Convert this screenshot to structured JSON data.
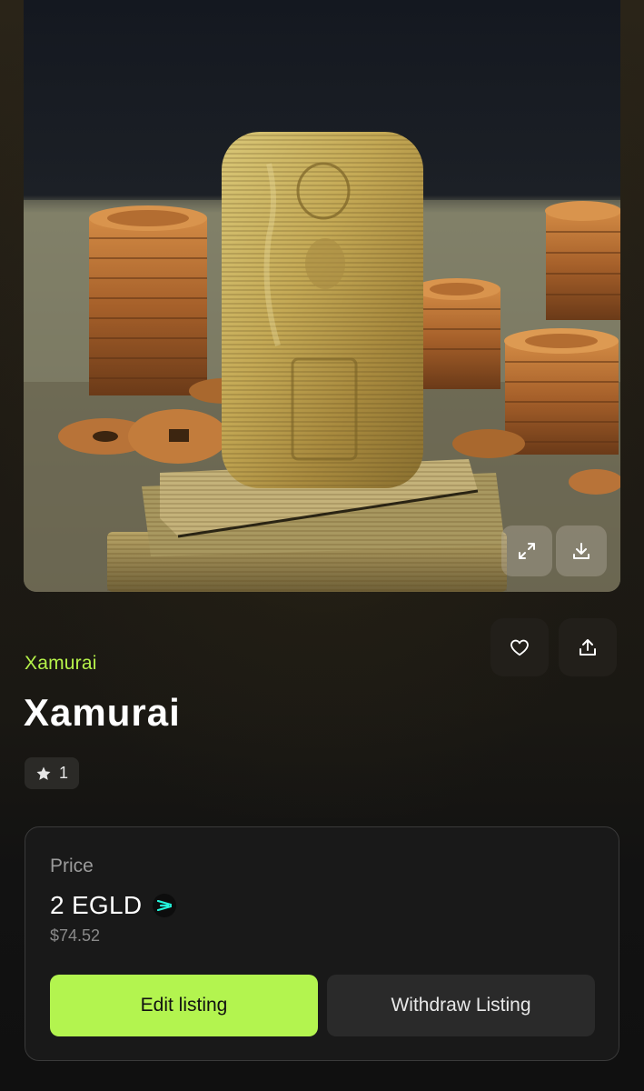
{
  "nft": {
    "collection": "Xamurai",
    "title": "Xamurai",
    "favorites_count": "1",
    "image_subject": "gold bar standing on a stack of gold plates among stacks of copper coins"
  },
  "media_actions": {
    "expand_icon": "expand-icon",
    "download_icon": "download-icon"
  },
  "actions": {
    "favorite_icon": "heart-icon",
    "share_icon": "share-icon"
  },
  "price": {
    "label": "Price",
    "amount": "2 EGLD",
    "token_icon": "egld-icon",
    "usd": "$74.52"
  },
  "buttons": {
    "edit_listing": "Edit listing",
    "withdraw_listing": "Withdraw Listing"
  },
  "colors": {
    "accent": "#b3f44f",
    "collection_link": "#b6f24a",
    "card_background": "#191919",
    "page_background": "#121212"
  }
}
